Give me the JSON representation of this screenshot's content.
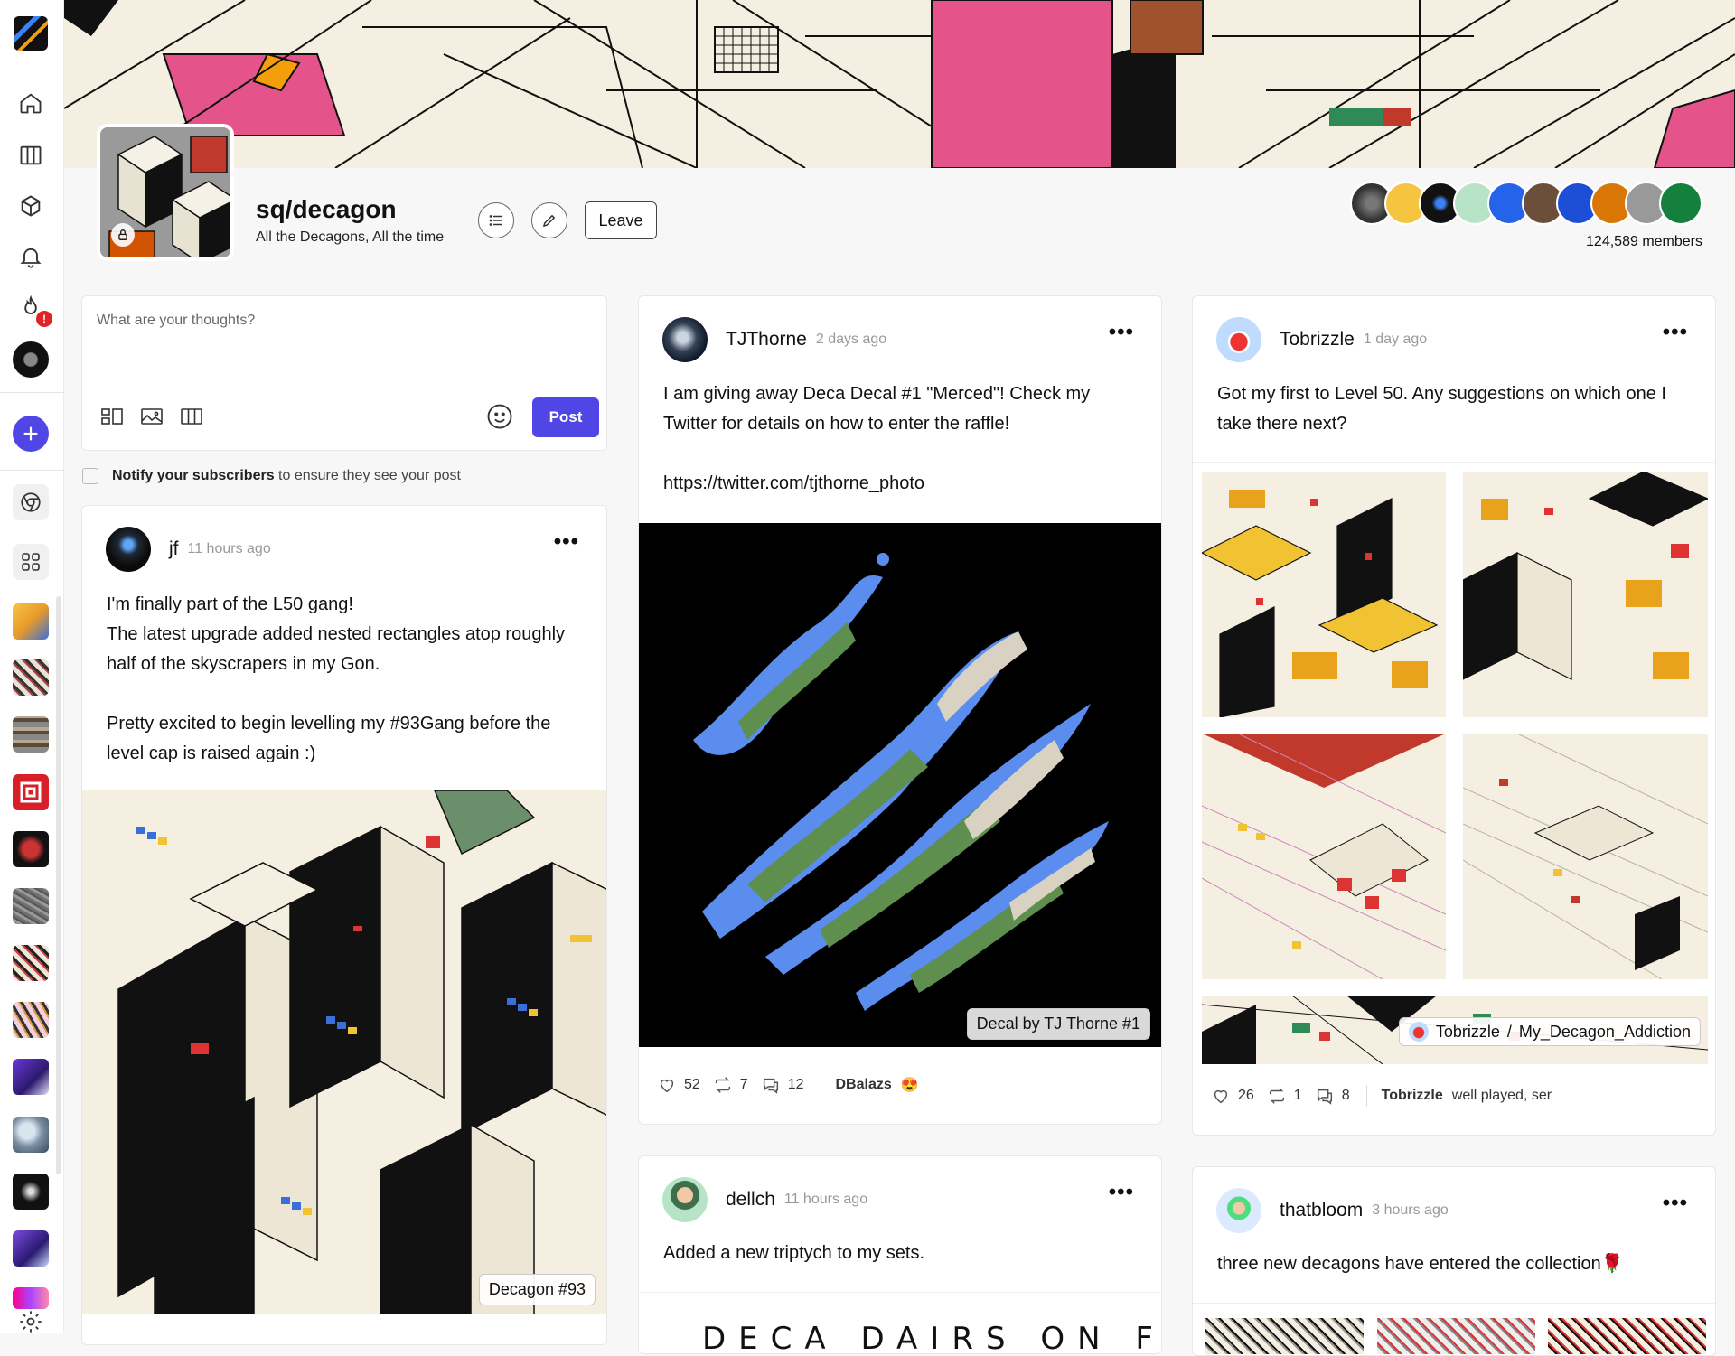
{
  "community": {
    "name": "sq/decagon",
    "tagline": "All the Decagons, All the time",
    "leave_label": "Leave",
    "members_count": "124,589 members"
  },
  "colors": {
    "accent": "#4f46e5",
    "banner_pink": "#e4538a",
    "notification": "#e02424"
  },
  "sidebar": {
    "notification_badge": "!",
    "icons": [
      "app-logo-icon",
      "home-icon",
      "columns-icon",
      "cube-icon",
      "bell-icon",
      "fire-icon",
      "profile-avatar",
      "plus-icon",
      "chrome-icon",
      "grid-icon"
    ]
  },
  "composer": {
    "placeholder": "What are your thoughts?",
    "post_label": "Post",
    "notify_bold": "Notify your subscribers",
    "notify_rest": " to ensure they see your post"
  },
  "posts": {
    "jf": {
      "author": "jf",
      "time": "11 hours ago",
      "text": "I'm finally part of the L50 gang!\nThe latest upgrade added nested rectangles atop roughly half of the skyscrapers in my Gon.\n\nPretty excited to begin levelling my #93Gang before the level cap is raised again :)",
      "image_caption": "Decagon #93"
    },
    "tjthorne": {
      "author": "TJThorne",
      "time": "2 days ago",
      "text": "I am giving away Deca Decal #1 \"Merced\"! Check my Twitter for details on how to enter the raffle!\n\nhttps://twitter.com/tjthorne_photo",
      "image_caption": "Decal by TJ Thorne #1",
      "likes": "52",
      "reposts": "7",
      "comments": "12",
      "top_comment_user": "DBalazs",
      "top_comment_text": "😍"
    },
    "dellch": {
      "author": "dellch",
      "time": "11 hours ago",
      "text": "Added a new triptych to my sets.",
      "image_text": "DECA DAIRS ON FRAME"
    },
    "tobrizzle": {
      "author": "Tobrizzle",
      "time": "1 day ago",
      "text": "Got my first to Level 50. Any suggestions on which one I take there next?",
      "collection_user": "Tobrizzle",
      "collection_sep": "/",
      "collection_name": "My_Decagon_Addiction",
      "likes": "26",
      "reposts": "1",
      "comments": "8",
      "top_comment_user": "Tobrizzle",
      "top_comment_text": "well played, ser"
    },
    "thatbloom": {
      "author": "thatbloom",
      "time": "3 hours ago",
      "text": "three new decagons have entered the collection🌹"
    }
  },
  "more_icon": "•••"
}
